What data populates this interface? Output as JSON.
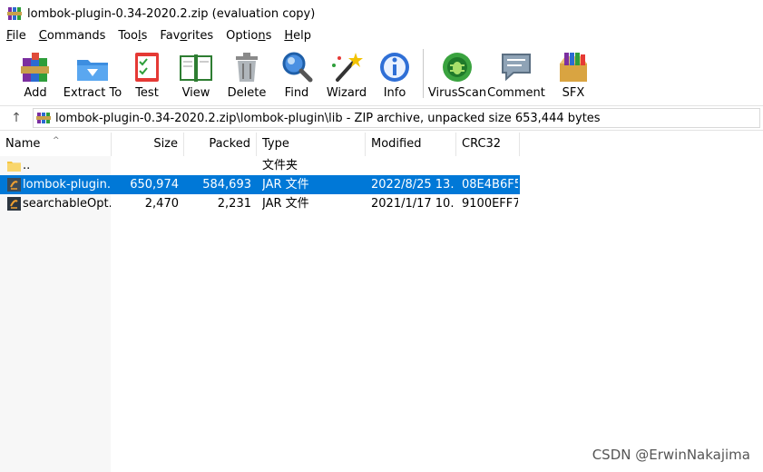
{
  "window": {
    "title": "lombok-plugin-0.34-2020.2.zip (evaluation copy)"
  },
  "menu": [
    {
      "label": "File",
      "accel": "F",
      "rest": "ile"
    },
    {
      "label": "Commands",
      "accel": "C",
      "rest": "ommands"
    },
    {
      "label": "Tools",
      "pre": "Too",
      "accel": "l",
      "rest": "s"
    },
    {
      "label": "Favorites",
      "pre": "Fav",
      "accel": "o",
      "rest": "rites"
    },
    {
      "label": "Options",
      "pre": "Optio",
      "accel": "n",
      "rest": "s"
    },
    {
      "label": "Help",
      "accel": "H",
      "rest": "elp"
    }
  ],
  "toolbar": {
    "add": "Add",
    "extract_to": "Extract To",
    "test": "Test",
    "view": "View",
    "delete": "Delete",
    "find": "Find",
    "wizard": "Wizard",
    "info": "Info",
    "virusscan": "VirusScan",
    "comment": "Comment",
    "sfx": "SFX"
  },
  "address": {
    "path": "lombok-plugin-0.34-2020.2.zip\\lombok-plugin\\lib - ZIP archive, unpacked size 653,444 bytes"
  },
  "columns": {
    "name": "Name",
    "size": "Size",
    "packed": "Packed",
    "type": "Type",
    "modified": "Modified",
    "crc32": "CRC32"
  },
  "rows": [
    {
      "name": "..",
      "size": "",
      "packed": "",
      "type": "文件夹",
      "modified": "",
      "crc": "",
      "icon": "folder-icon"
    },
    {
      "name": "lombok-plugin...",
      "size": "650,974",
      "packed": "584,693",
      "type": "JAR 文件",
      "modified": "2022/8/25 13...",
      "crc": "08E4B6F5",
      "icon": "jar-file-icon",
      "selected": true
    },
    {
      "name": "searchableOpt...",
      "size": "2,470",
      "packed": "2,231",
      "type": "JAR 文件",
      "modified": "2021/1/17 10...",
      "crc": "9100EFF7",
      "icon": "jar-file-icon"
    }
  ],
  "watermark": "CSDN @ErwinNakajima",
  "colors": {
    "selection": "#0078d7",
    "separator": "#e3e3e3"
  }
}
